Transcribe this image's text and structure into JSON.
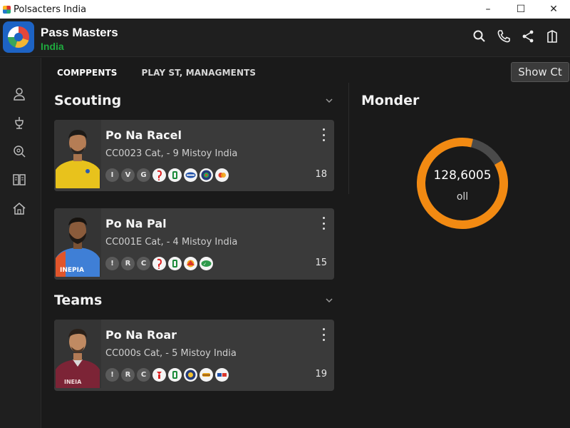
{
  "window": {
    "title": "Polsacters India",
    "controls": [
      "–",
      "☐",
      "✕"
    ]
  },
  "header": {
    "brand_name": "Pass Masters",
    "brand_sub": "India",
    "icons": [
      "search-icon",
      "phone-icon",
      "share-icon",
      "bookmark-icon"
    ]
  },
  "sidebar": {
    "icons": [
      "user-icon",
      "trophy-icon",
      "search-icon",
      "book-icon",
      "home-icon"
    ]
  },
  "tabs": [
    {
      "label": "COMPPENTS",
      "active": true
    },
    {
      "label": "PLAY ST, MANAGMENTS",
      "active": false
    }
  ],
  "show_button": "Show Ct",
  "sections": {
    "scouting": "Scouting",
    "teams": "Teams"
  },
  "players": [
    {
      "name": "Po Na Racel",
      "meta": "CC0023 Cat, - 9 Mistoy India",
      "count": "18",
      "letter_badges": [
        "I",
        "V",
        "G"
      ],
      "jersey": "yellow",
      "jersey_color": "#e8c21c"
    },
    {
      "name": "Po Na Pal",
      "meta": "CC001E Cat, - 4 Mistoy India",
      "count": "15",
      "letter_badges": [
        "!",
        "R",
        "C"
      ],
      "jersey": "blue",
      "jersey_color": "#3f7fd6",
      "jersey_text": "INEPIA"
    },
    {
      "name": "Po Na Roar",
      "meta": "CC000s Cat, - 5 Mistoy India",
      "count": "19",
      "letter_badges": [
        "!",
        "R",
        "C"
      ],
      "jersey": "maroon",
      "jersey_color": "#7c2436",
      "jersey_text": "INEIA"
    }
  ],
  "monder": {
    "title": "Monder",
    "value": "128,6005",
    "label": "oll",
    "fraction": 0.87,
    "ring_color": "#f28a12",
    "track_color": "#4a4a4a"
  }
}
